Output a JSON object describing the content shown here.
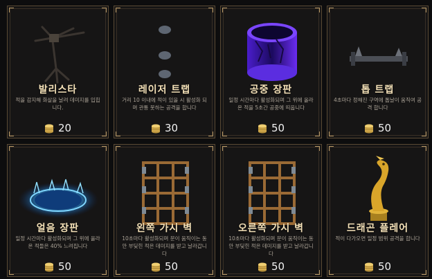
{
  "cards": [
    {
      "title": "발리스타",
      "desc": "적을 감지해 화살을 날려 데미지를 입힙니다.",
      "cost": "20",
      "icon": "ballista-icon"
    },
    {
      "title": "레이저 트랩",
      "desc": "거리 10 이내에 적이 있을 시 활성화 되며 관통 못하는 공격을 합니다",
      "cost": "30",
      "icon": "laser-trap-icon"
    },
    {
      "title": "공중 장판",
      "desc": "일정 시간마다 활성화되며 그 위에 올라온 적을 5초간 공중에 띄웁니다",
      "cost": "50",
      "icon": "air-field-icon"
    },
    {
      "title": "톱 트랩",
      "desc": "4초마다 정해진 구역에 톱날이 움직여 공격 합니다",
      "cost": "50",
      "icon": "saw-trap-icon"
    },
    {
      "title": "얼음 장판",
      "desc": "일정 시간마다 활성화되며 그 위에 올라온 적들은 40% 느려집니다",
      "cost": "50",
      "icon": "ice-field-icon"
    },
    {
      "title": "왼쪽 가시 벽",
      "desc": "10초마다 활성화되며 문이 움직이는 동안 부딪힌 적은 데미지를 받고 날라갑니다",
      "cost": "50",
      "icon": "left-spike-wall-icon"
    },
    {
      "title": "오른쪽 가시 벽",
      "desc": "10초마다 활성화되며 문이 움직이는 동안 부딪힌 적은 데미지를 받고 날라갑니다",
      "cost": "50",
      "icon": "right-spike-wall-icon"
    },
    {
      "title": "드래곤 플레어",
      "desc": "적이 다가오면 일정 범위 공격을 합니다",
      "cost": "50",
      "icon": "dragon-flare-icon"
    }
  ]
}
